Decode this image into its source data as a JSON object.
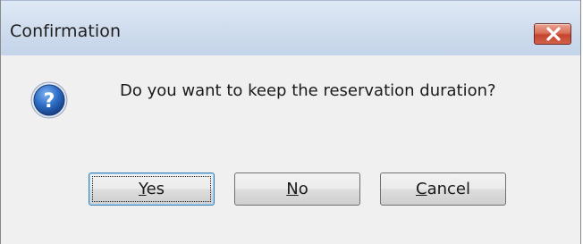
{
  "window": {
    "title": "Confirmation"
  },
  "icons": {
    "message_icon": "question-icon",
    "close_icon": "close-icon"
  },
  "colors": {
    "title_bar": "#cfdced",
    "close_button": "#c4442e",
    "content_bg": "#f0f0f0",
    "question_icon": "#1f5fb8"
  },
  "message": {
    "text": "Do you want to keep the reservation duration?"
  },
  "buttons": {
    "yes": {
      "mnemonic": "Y",
      "rest": "es"
    },
    "no": {
      "mnemonic": "N",
      "rest": "o"
    },
    "cancel": {
      "mnemonic": "C",
      "rest": "ancel"
    }
  }
}
